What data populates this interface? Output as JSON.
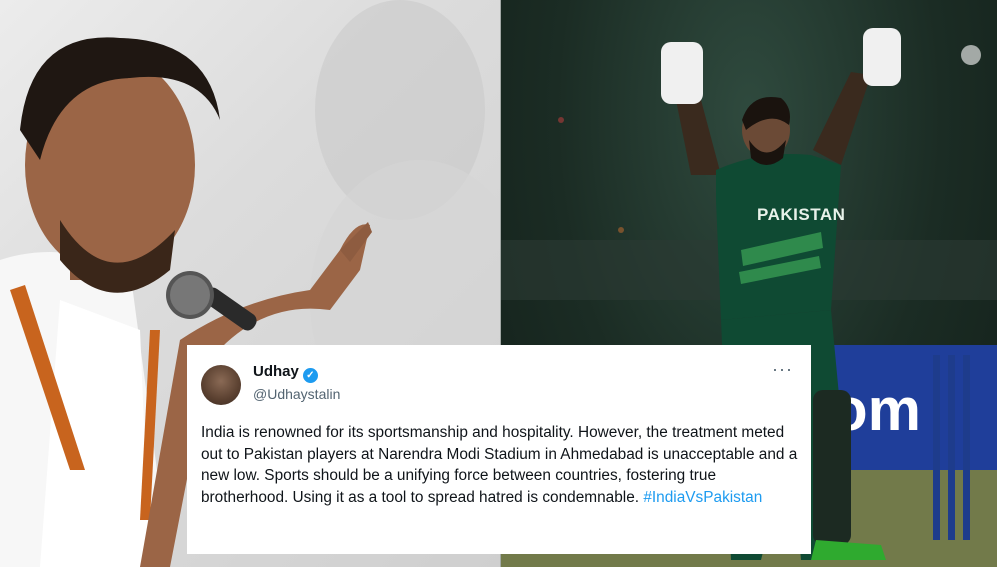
{
  "tweet": {
    "display_name": "Udhay",
    "handle": "@Udhaystalin",
    "body": "India is renowned for its sportsmanship and hospitality. However, the treatment meted out to Pakistan players at Narendra Modi Stadium in Ahmedabad is unacceptable and a new low. Sports should be a unifying force between countries, fostering true brotherhood. Using it as a tool to spread hatred is condemnable.",
    "hashtag": "#IndiaVsPakistan",
    "more_label": "···",
    "verified_glyph": "✓"
  },
  "photo_right": {
    "jersey_text": "PAKISTAN"
  },
  "colors": {
    "link": "#1d9bf0",
    "jersey": "#0f4a33",
    "stumps": "#1e3c8c"
  }
}
